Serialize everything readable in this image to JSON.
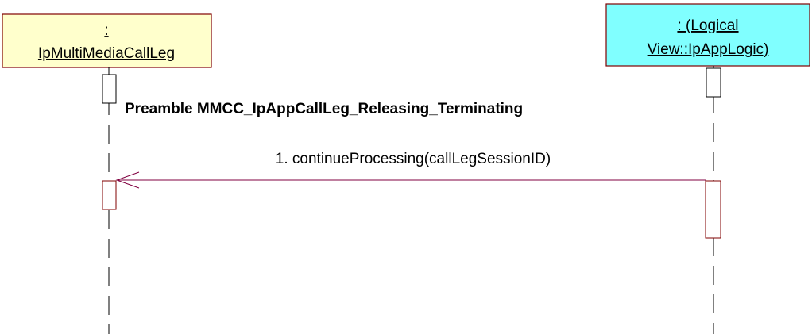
{
  "participants": [
    {
      "id": "mmcl",
      "label_lines": [
        ":",
        "IpMultiMediaCallLeg"
      ],
      "fill": "#ffffcc"
    },
    {
      "id": "app",
      "label_lines": [
        ": (Logical",
        "View::IpAppLogic)"
      ],
      "fill": "#80ffff"
    }
  ],
  "note": "Preamble MMCC_IpAppCallLeg_Releasing_Terminating",
  "messages": [
    {
      "label": "1. continueProcessing(callLegSessionID)",
      "from": "app",
      "to": "mmcl"
    }
  ],
  "colors": {
    "box_border": "#800000",
    "activation_border": "#800000",
    "message_line": "#800040",
    "lifeline": "#000000"
  }
}
